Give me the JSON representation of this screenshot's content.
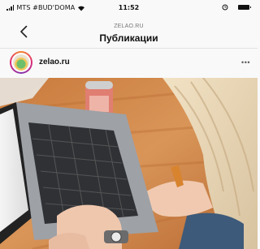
{
  "status_bar": {
    "carrier": "MTS #BUD'DOMA",
    "time": "11:52",
    "icons": [
      "signal-icon",
      "wifi-icon",
      "alarm-icon",
      "battery-icon"
    ]
  },
  "nav": {
    "subtitle": "ZELAO.RU",
    "title": "Публикации",
    "back_icon": "chevron-left-icon"
  },
  "post": {
    "username": "zelao.ru",
    "more_icon": "more-horizontal-icon",
    "image_icon": "photo-laptop-on-desk"
  },
  "colors": {
    "background": "#f9f9f9",
    "story_ring_start": "#f58529",
    "story_ring_end": "#8134af"
  }
}
